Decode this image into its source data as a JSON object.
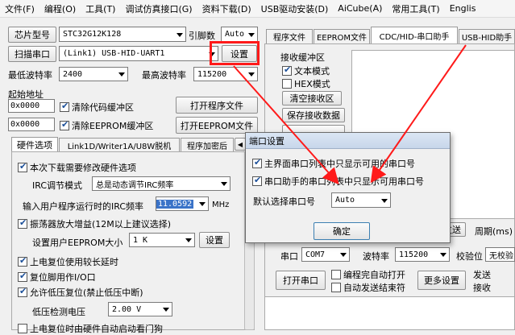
{
  "menu": [
    "文件(F)",
    "编程(O)",
    "工具(T)",
    "调试仿真接口(G)",
    "资料下载(D)",
    "USB驱动安装(D)",
    "AiCube(A)",
    "常用工具(T)",
    "Englis"
  ],
  "left": {
    "chip_btn": "芯片型号",
    "chip_value": "STC32G12K128",
    "pin_label": "引脚数",
    "pin_value": "Auto",
    "scan_btn": "扫描串口",
    "port_value": "(Link1) USB-HID-UART1",
    "settings_btn": "设置",
    "min_baud_label": "最低波特率",
    "min_baud_value": "2400",
    "max_baud_label": "最高波特率",
    "max_baud_value": "115200",
    "start_addr_label": "起始地址",
    "addr1": "0x0000",
    "clear_code": "清除代码缓冲区",
    "open_prog_btn": "打开程序文件",
    "addr2": "0x0000",
    "clear_eeprom": "清除EEPROM缓冲区",
    "open_eeprom_btn": "打开EEPROM文件",
    "tabs": [
      "硬件选项",
      "Link1D/Writer1A/U8W脱机",
      "程序加密后"
    ],
    "opt_modify": "本次下载需要修改硬件选项",
    "irc_mode_label": "IRC调节模式",
    "irc_mode_value": "总是动态调节IRC频率",
    "irc_freq_label": "输入用户程序运行时的IRC频率",
    "irc_freq_value": "11.0592",
    "irc_unit": "MHz",
    "osc_gain": "振荡器放大增益(12M以上建议选择)",
    "eeprom_size_label": "设置用户EEPROM大小",
    "eeprom_size_value": "1   K",
    "eeprom_set_btn": "设置",
    "power_reset": "上电复位使用较长延时",
    "reset_pin": "复位脚用作I/O口",
    "lvd_reset": "允许低压复位(禁止低压中断)",
    "lvd_label": "低压检测电压",
    "lvd_value": "2.00 V",
    "wdt": "上电复位时由硬件自动启动看门狗"
  },
  "right": {
    "tabs": [
      "程序文件",
      "EEPROM文件",
      "CDC/HID-串口助手",
      "USB-HID助手"
    ],
    "recv_title": "接收缓冲区",
    "text_mode": "文本模式",
    "hex_mode": "HEX模式",
    "clear_recv": "清空接收区",
    "save_recv": "保存接收数据",
    "send_btn": "发送",
    "period_label": "周期(ms)",
    "port_label": "串口",
    "port_value": "COM7",
    "baud_label": "波特率",
    "baud_value": "115200",
    "verify_label": "校验位",
    "verify_value": "无校验",
    "open_port_btn": "打开串口",
    "auto_open": "编程完自动打开",
    "auto_send": "自动发送结束符",
    "more_btn": "更多设置",
    "send_label": "发送",
    "recv_label": "接收"
  },
  "dialog": {
    "title": "端口设置",
    "opt1": "主界面串口列表中只显示可用的串口号",
    "opt2": "串口助手的串口列表中只显示可用串口号",
    "default_label": "默认选择串口号",
    "default_value": "Auto",
    "ok_btn": "确定"
  },
  "colors": {
    "highlight": "#ff1a1a",
    "freq_bg": "#3a73c8"
  }
}
